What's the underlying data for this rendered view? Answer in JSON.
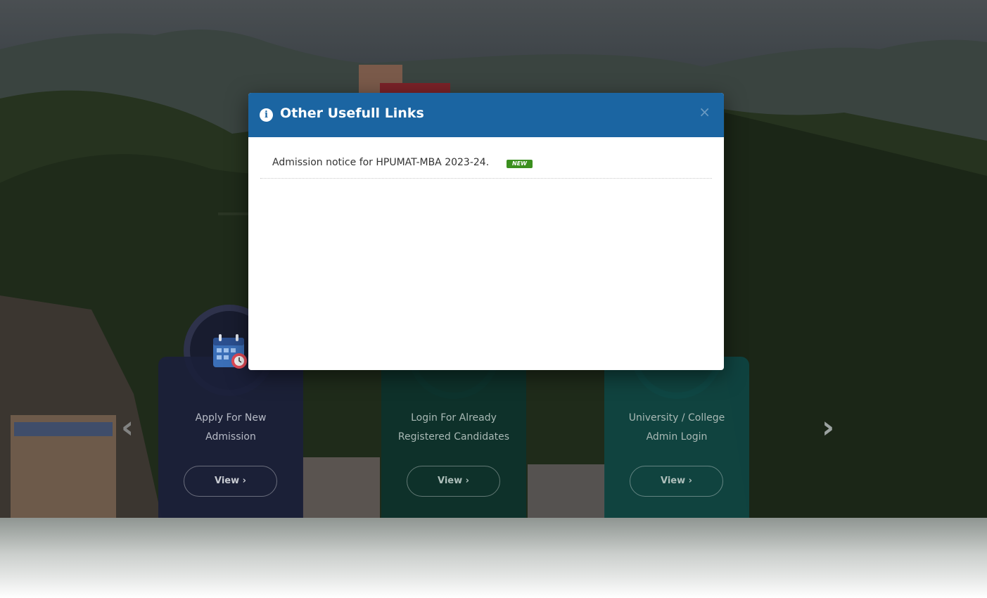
{
  "modal": {
    "title": "Other Usefull Links",
    "close_label": "×",
    "links": [
      {
        "text": "Admission notice for HPUMAT-MBA 2023-24.",
        "badge": "NEW"
      }
    ]
  },
  "cards": [
    {
      "title_line1": "Apply For New",
      "title_line2": "Admission",
      "button": "View ›"
    },
    {
      "title_line1": "Login For Already",
      "title_line2": "Registered Candidates",
      "button": "View ›"
    },
    {
      "title_line1": "University / College",
      "title_line2": "Admin Login",
      "button": "View ›"
    }
  ],
  "carousel": {
    "prev": "‹",
    "next": "›"
  },
  "colors": {
    "modal_header": "#1b65a2",
    "badge": "#3b8f1e",
    "card_1": "#1b1f3a",
    "card_2": "#0c322c",
    "card_3": "#0e4644"
  },
  "icons": {
    "modal": "info-circle-icon",
    "card_1": "calendar-icon"
  }
}
